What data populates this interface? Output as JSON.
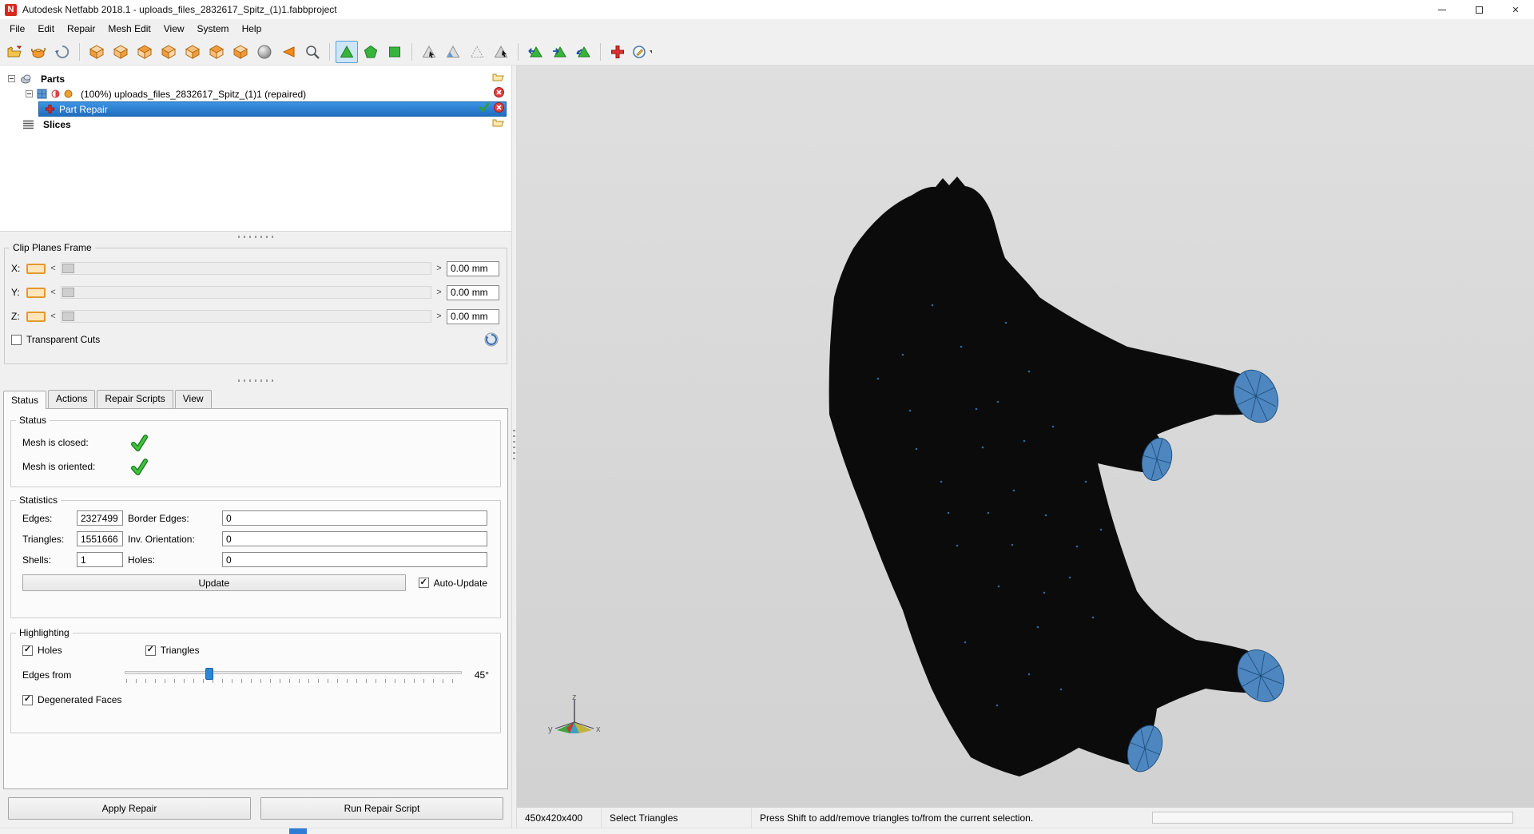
{
  "window": {
    "title": "Autodesk Netfabb 2018.1 - uploads_files_2832617_Spitz_(1)1.fabbproject"
  },
  "menu": {
    "items": [
      "File",
      "Edit",
      "Repair",
      "Mesh Edit",
      "View",
      "System",
      "Help"
    ]
  },
  "tree": {
    "parts_label": "Parts",
    "part_label": "(100%) uploads_files_2832617_Spitz_(1)1 (repaired)",
    "part_repair_label": "Part Repair",
    "slices_label": "Slices"
  },
  "clip": {
    "title": "Clip Planes Frame",
    "x_label": "X:",
    "y_label": "Y:",
    "z_label": "Z:",
    "x_value": "0.00 mm",
    "y_value": "0.00 mm",
    "z_value": "0.00 mm",
    "left_arrow": "<",
    "right_arrow": ">",
    "transparent_cuts_label": "Transparent Cuts"
  },
  "tabs": {
    "status": "Status",
    "actions": "Actions",
    "repair_scripts": "Repair Scripts",
    "view": "View"
  },
  "status_group": {
    "title": "Status",
    "mesh_closed_label": "Mesh is closed:",
    "mesh_oriented_label": "Mesh is oriented:"
  },
  "statistics": {
    "title": "Statistics",
    "edges_label": "Edges:",
    "edges_value": "2327499",
    "border_edges_label": "Border Edges:",
    "border_edges_value": "0",
    "triangles_label": "Triangles:",
    "triangles_value": "1551666",
    "inv_orientation_label": "Inv. Orientation:",
    "inv_orientation_value": "0",
    "shells_label": "Shells:",
    "shells_value": "1",
    "holes_label": "Holes:",
    "holes_value": "0",
    "update_label": "Update",
    "auto_update_label": "Auto-Update"
  },
  "highlighting": {
    "title": "Highlighting",
    "holes_label": "Holes",
    "triangles_label": "Triangles",
    "edges_from_label": "Edges from",
    "angle_value": "45°",
    "degenerated_label": "Degenerated Faces"
  },
  "footer": {
    "apply_repair": "Apply Repair",
    "run_repair_script": "Run Repair Script"
  },
  "statusbar": {
    "dimensions": "450x420x400",
    "mode": "Select Triangles",
    "hint": "Press Shift to add/remove triangles to/from the current selection."
  },
  "viewport": {
    "axis_x": "x",
    "axis_y": "y",
    "axis_z": "z"
  },
  "colors": {
    "selection_blue": "#2b83d8",
    "check_green": "#2f9e2f",
    "paw_blue": "#4e86c0",
    "cube_orange": "#ef9b3c"
  }
}
